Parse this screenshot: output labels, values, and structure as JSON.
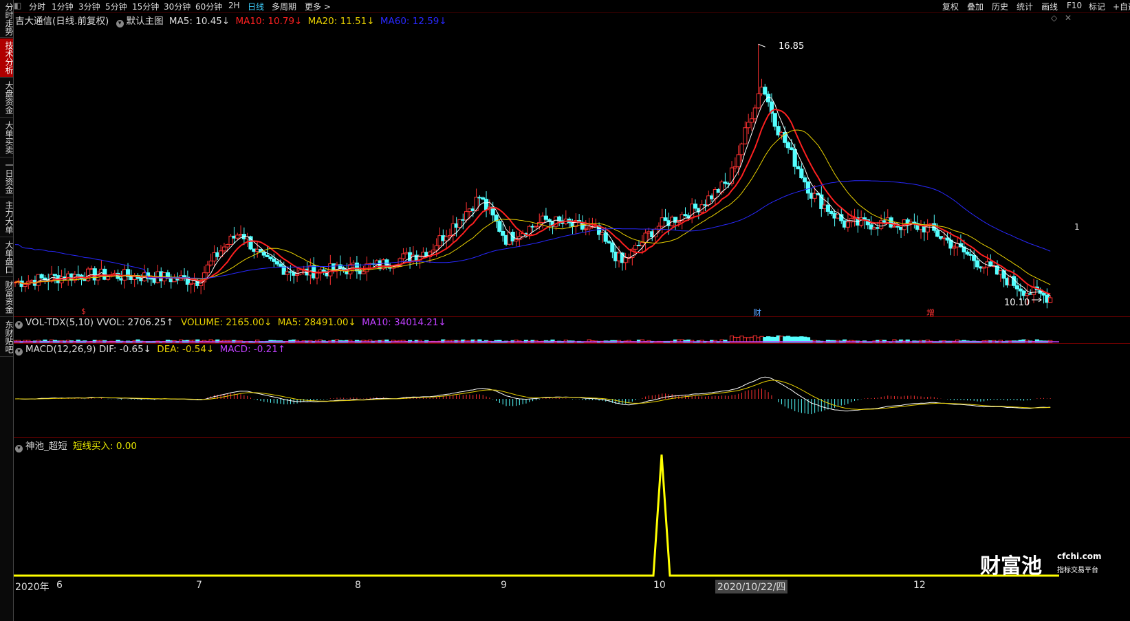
{
  "topbar": {
    "tabs": [
      "分时",
      "1分钟",
      "3分钟",
      "5分钟",
      "15分钟",
      "30分钟",
      "60分钟",
      "2H",
      "日线",
      "多周期",
      "更多 >"
    ],
    "active_tab": "日线",
    "right": [
      "复权",
      "叠加",
      "历史",
      "统计",
      "画线",
      "F10",
      "标记",
      "+自选"
    ]
  },
  "sidebar": [
    "分时走势",
    "技术分析",
    "大盘资金",
    "大单买卖",
    "一日资金",
    "主力大单",
    "大单盘口",
    "财富资金",
    "东财贴吧"
  ],
  "main_header": {
    "stock": "吉大通信(日线.前复权)",
    "template": "默认主图",
    "ma5": "MA5: 10.45↓",
    "ma10": "MA10: 10.79↓",
    "ma20": "MA20: 11.51↓",
    "ma60": "MA60: 12.59↓"
  },
  "price_annotations": {
    "high": "16.85",
    "low": "10.10",
    "marker_s": "$",
    "marker_cai": "财",
    "marker_zeng": "增",
    "right_edge": "1"
  },
  "vol_header": {
    "name": "VOL-TDX(5,10) VVOL: 2706.25↑",
    "volume": "VOLUME: 2165.00↓",
    "ma5": "MA5: 28491.00↓",
    "ma10": "MA10: 34014.21↓"
  },
  "macd_header": {
    "name": "MACD(12,26,9) DIF: -0.65↓",
    "dea": "DEA: -0.54↓",
    "macd": "MACD: -0.21↑"
  },
  "ind_header": {
    "name": "神池_超短",
    "value": "短线买入: 0.00"
  },
  "axis": {
    "year": "2020年",
    "m6": "6",
    "m7": "7",
    "m8": "8",
    "m9": "9",
    "m10": "10",
    "date": "2020/10/22/四",
    "m12": "12"
  },
  "logo": {
    "brand": "财富池",
    "url": "cfchi.com",
    "slogan": "指标交易平台"
  },
  "colors": {
    "up": "#ff3232",
    "down": "#54ffff",
    "ma5": "#ffffff",
    "ma10": "#ff2020",
    "ma20": "#e8d000",
    "ma60": "#2828ff",
    "vol_ma10": "#c040ff",
    "signal": "#ffff00"
  },
  "chart_data": {
    "type": "candlestick",
    "title": "吉大通信(日线.前复权)",
    "price_high": 16.85,
    "price_low": 10.1,
    "ma_lines": [
      {
        "name": "MA5",
        "last": 10.45
      },
      {
        "name": "MA10",
        "last": 10.79
      },
      {
        "name": "MA20",
        "last": 11.51
      },
      {
        "name": "MA60",
        "last": 12.59
      }
    ],
    "volume": {
      "vvol": 2706.25,
      "volume": 2165.0,
      "ma5": 28491.0,
      "ma10": 34014.21
    },
    "macd": {
      "dif": -0.65,
      "dea": -0.54,
      "macd": -0.21
    },
    "indicator": {
      "name": "神池_超短",
      "series": "短线买入",
      "last": 0.0,
      "spike_month": "10"
    }
  }
}
